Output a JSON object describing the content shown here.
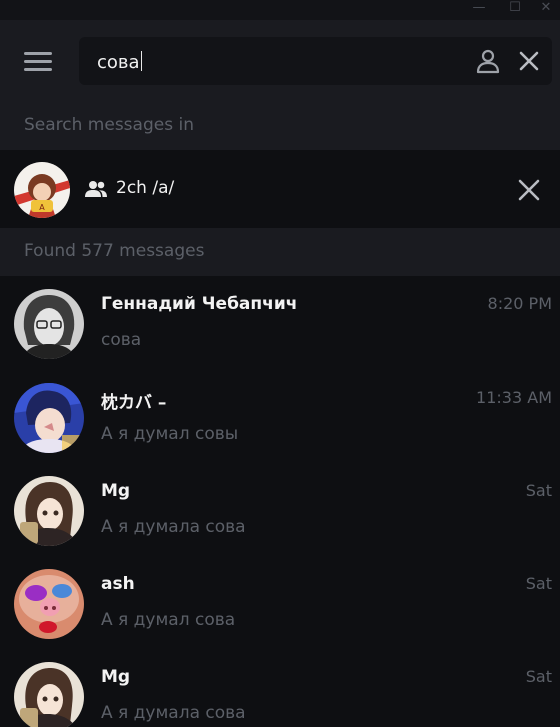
{
  "window": {
    "minimize_glyph": "—",
    "maximize_glyph": "☐",
    "close_glyph": "✕"
  },
  "search": {
    "query": "сова",
    "user_filter_icon": "person-icon",
    "clear_icon": "close-icon"
  },
  "search_in": {
    "label": "Search messages in"
  },
  "chat_filter": {
    "name": "2ch /a/",
    "type_icon": "group-icon"
  },
  "results": {
    "found_label": "Found 577 messages",
    "items": [
      {
        "sender": "Геннадий Чебапчич",
        "time": "8:20 PM",
        "text": "сова"
      },
      {
        "sender": "枕カバ –",
        "time": "11:33 AM",
        "text": "А я думал совы"
      },
      {
        "sender": "Mg",
        "time": "Sat",
        "text": "А я думала сова"
      },
      {
        "sender": "ash",
        "time": "Sat",
        "text": "А я думал сова"
      },
      {
        "sender": "Mg",
        "time": "Sat",
        "text": "А я думала сова"
      }
    ]
  },
  "colors": {
    "background": "#0e0f12",
    "header": "#1a1b20",
    "muted_text": "#5c6068",
    "primary_text": "#f1f1f1"
  }
}
